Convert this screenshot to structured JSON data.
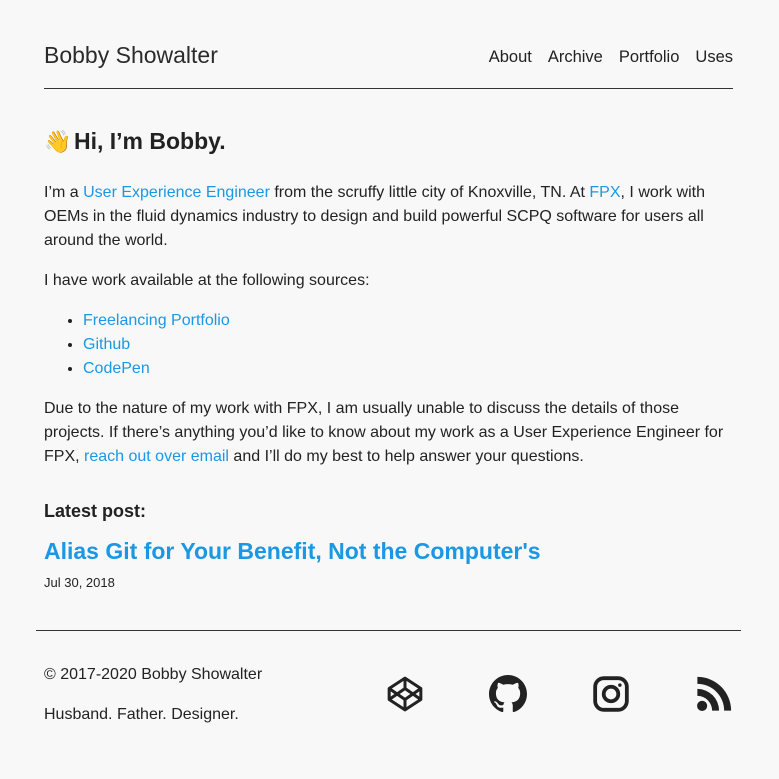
{
  "site": {
    "title": "Bobby Showalter"
  },
  "nav": {
    "items": [
      "About",
      "Archive",
      "Portfolio",
      "Uses"
    ]
  },
  "intro": {
    "wave_emoji": "👋",
    "greeting": "Hi, I’m Bobby.",
    "p1_a": "I’m a ",
    "p1_link_role": "User Experience Engineer",
    "p1_b": " from the scruffy little city of Knoxville, TN. At ",
    "p1_link_company": "FPX",
    "p1_c": ", I work with OEMs in the fluid dynamics industry to design and build powerful SCPQ software for users all around the world.",
    "p2": "I have work available at the following sources:",
    "sources": [
      "Freelancing Portfolio",
      "Github",
      "CodePen"
    ],
    "p3_a": "Due to the nature of my work with FPX, I am usually unable to discuss the details of those projects. If there’s anything you’d like to know about my work as a User Experience Engineer for FPX, ",
    "p3_link_email": "reach out over email",
    "p3_b": " and I’ll do my best to help answer your questions."
  },
  "latest": {
    "label": "Latest post:",
    "title": "Alias Git for Your Benefit, Not the Computer's",
    "date": "Jul 30, 2018"
  },
  "footer": {
    "copyright": "© 2017-2020 Bobby Showalter",
    "tagline": "Husband. Father. Designer.",
    "social_icons": [
      "codepen-icon",
      "github-icon",
      "instagram-icon",
      "rss-icon"
    ]
  },
  "colors": {
    "link": "#1b97e3",
    "text": "#222222",
    "background": "#f8f8f8"
  }
}
